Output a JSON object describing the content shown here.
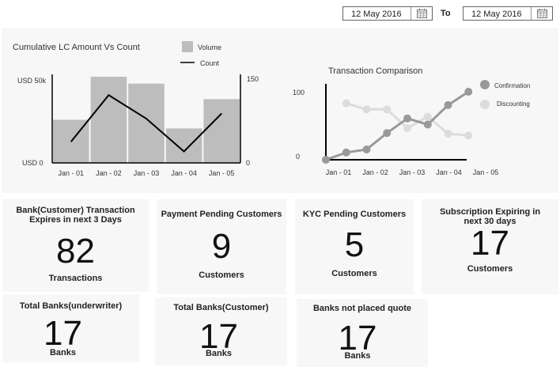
{
  "filters": {
    "from_date": "12 May 2016",
    "to_label": "To",
    "to_date": "12 May 2016",
    "calendar_icon": "calendar-icon"
  },
  "chart_data": [
    {
      "type": "bar",
      "title": "Cumulative LC Amount Vs Count",
      "categories": [
        "Jan - 01",
        "Jan - 02",
        "Jan - 03",
        "Jan - 04",
        "Jan - 05"
      ],
      "series": [
        {
          "name": "Volume",
          "type": "bar",
          "axis": "left",
          "values": [
            25000,
            50000,
            46000,
            20000,
            37000
          ],
          "color": "#bdbdbd"
        },
        {
          "name": "Count",
          "type": "line",
          "axis": "right",
          "values": [
            37,
            118,
            77,
            20,
            86
          ],
          "color": "#000000"
        }
      ],
      "left_axis": {
        "ticks": [
          "USD 50k",
          "USD 0"
        ],
        "range": [
          0,
          50000
        ]
      },
      "right_axis": {
        "ticks": [
          "150",
          "0"
        ],
        "range": [
          0,
          150
        ]
      },
      "legend": "top-right",
      "grid": false
    },
    {
      "type": "line",
      "title": "Transaction Comparison",
      "categories": [
        "Jan - 01",
        "Jan - 02",
        "Jan - 03",
        "Jan - 04",
        "Jan - 05"
      ],
      "x": [
        1,
        1.5,
        2,
        2.5,
        3,
        3.5,
        4,
        4.5
      ],
      "series": [
        {
          "name": "Confirmation",
          "values": [
            0,
            12,
            17,
            44,
            68,
            58,
            90,
            112
          ],
          "color": "#999999"
        },
        {
          "name": "Discounting",
          "values": [
            null,
            93,
            83,
            83,
            52,
            71,
            43,
            40
          ],
          "color": "#dcdcdc"
        }
      ],
      "y_axis": {
        "ticks": [
          "100",
          "0"
        ],
        "range": [
          0,
          100
        ]
      },
      "legend": "right",
      "grid": false
    }
  ],
  "cards": [
    {
      "title": "Bank(Customer) Transaction Expires in next 3 Days",
      "value": "82",
      "unit": "Transactions"
    },
    {
      "title": "Payment Pending Customers",
      "value": "9",
      "unit": "Customers"
    },
    {
      "title": "KYC Pending Customers",
      "value": "5",
      "unit": "Customers"
    },
    {
      "title": "Subscription Expiring in next 30 days",
      "value": "17",
      "unit": "Customers"
    },
    {
      "title": "Total Banks(underwriter)",
      "value": "17",
      "unit": "Banks"
    },
    {
      "title": "Total Banks(Customer)",
      "value": "17",
      "unit": "Banks"
    },
    {
      "title": "Banks not placed quote",
      "value": "17",
      "unit": "Banks"
    }
  ]
}
